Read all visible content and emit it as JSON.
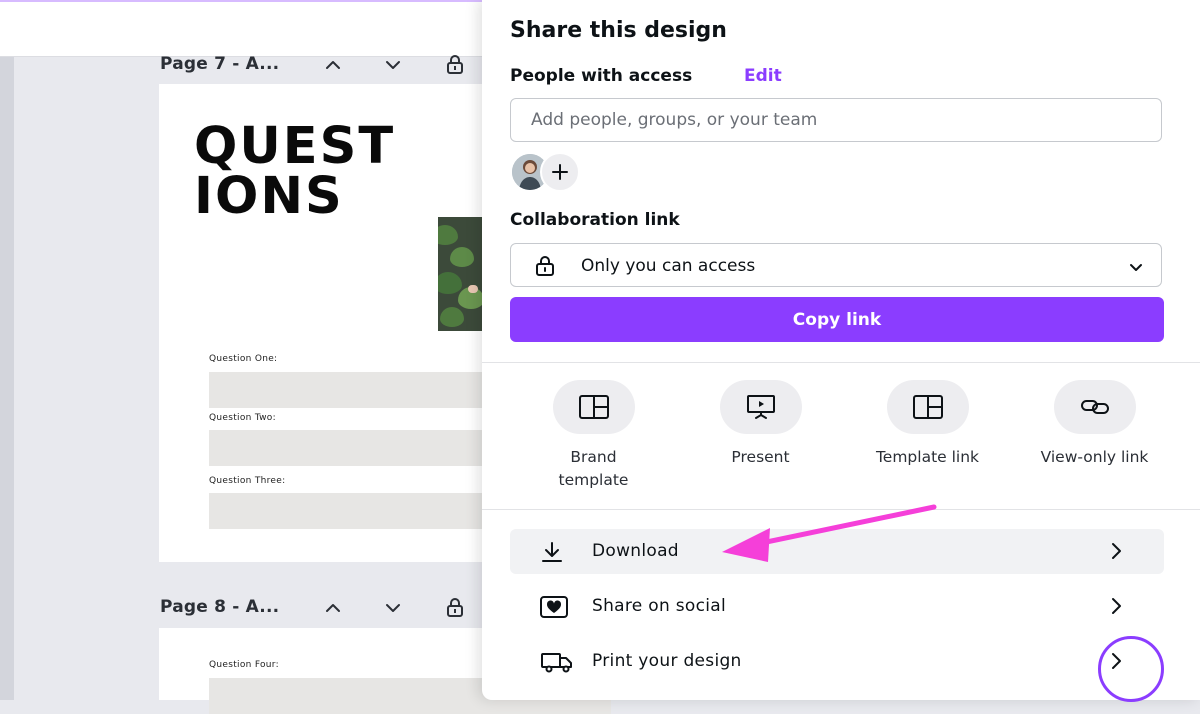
{
  "pages": [
    {
      "label": "Page 7 - A...",
      "title": "QUEST\nIONS",
      "questions": [
        "Question One:",
        "Question Two:",
        "Question Three:"
      ]
    },
    {
      "label": "Page 8 - A...",
      "questions": [
        "Question Four:"
      ]
    }
  ],
  "share": {
    "title": "Share this design",
    "people_label": "People with access",
    "edit_label": "Edit",
    "add_placeholder": "Add people, groups, or your team",
    "collab_label": "Collaboration link",
    "collab_value": "Only you can access",
    "copy_label": "Copy link",
    "options": [
      {
        "label": "Brand\ntemplate",
        "icon": "layout-icon"
      },
      {
        "label": "Present",
        "icon": "presentation-icon"
      },
      {
        "label": "Template link",
        "icon": "layout-icon"
      },
      {
        "label": "View-only link",
        "icon": "link-icon"
      }
    ],
    "actions": [
      {
        "label": "Download",
        "icon": "download-icon"
      },
      {
        "label": "Share on social",
        "icon": "heart-icon"
      },
      {
        "label": "Print your design",
        "icon": "truck-icon"
      }
    ]
  },
  "colors": {
    "accent": "#8b3dff",
    "annotation_arrow": "#f53fd9"
  }
}
